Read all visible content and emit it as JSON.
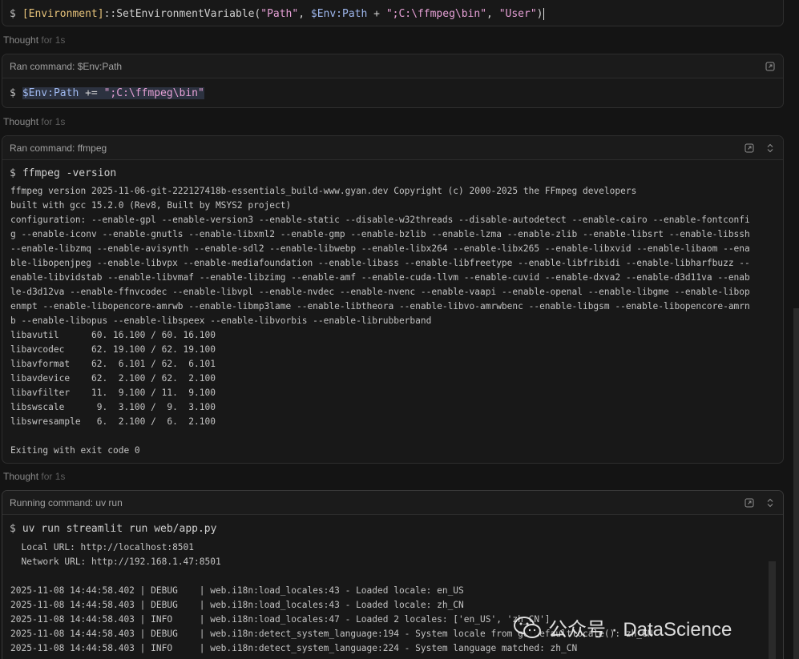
{
  "cards": {
    "card1": {
      "cmd": {
        "prompt": "$",
        "p1": "[Environment]",
        "p2": "::SetEnvironmentVariable(",
        "p3": "\"Path\"",
        "p4": ", ",
        "p5": "$Env:Path",
        "p6": " + ",
        "p7": "\";C:\\ffmpeg\\bin\"",
        "p8": ", ",
        "p9": "\"User\"",
        "p10": ")"
      }
    },
    "card2": {
      "title": "Ran command: $Env:Path",
      "cmd": {
        "prompt": "$",
        "p1": "$Env:Path",
        "p2": " += ",
        "p3": "\";C:\\ffmpeg\\bin\""
      }
    },
    "card3": {
      "title": "Ran command: ffmpeg",
      "cmd": {
        "prompt": "$",
        "text": "ffmpeg -version"
      },
      "output": [
        "ffmpeg version 2025-11-06-git-222127418b-essentials_build-www.gyan.dev Copyright (c) 2000-2025 the FFmpeg developers",
        "built with gcc 15.2.0 (Rev8, Built by MSYS2 project)",
        "configuration: --enable-gpl --enable-version3 --enable-static --disable-w32threads --disable-autodetect --enable-cairo --enable-fontconfi",
        "g --enable-iconv --enable-gnutls --enable-libxml2 --enable-gmp --enable-bzlib --enable-lzma --enable-zlib --enable-libsrt --enable-libssh",
        "--enable-libzmq --enable-avisynth --enable-sdl2 --enable-libwebp --enable-libx264 --enable-libx265 --enable-libxvid --enable-libaom --ena",
        "ble-libopenjpeg --enable-libvpx --enable-mediafoundation --enable-libass --enable-libfreetype --enable-libfribidi --enable-libharfbuzz --",
        "enable-libvidstab --enable-libvmaf --enable-libzimg --enable-amf --enable-cuda-llvm --enable-cuvid --enable-dxva2 --enable-d3d11va --enab",
        "le-d3d12va --enable-ffnvcodec --enable-libvpl --enable-nvdec --enable-nvenc --enable-vaapi --enable-openal --enable-libgme --enable-libop",
        "enmpt --enable-libopencore-amrwb --enable-libmp3lame --enable-libtheora --enable-libvo-amrwbenc --enable-libgsm --enable-libopencore-amrn",
        "b --enable-libopus --enable-libspeex --enable-libvorbis --enable-librubberband",
        "libavutil      60. 16.100 / 60. 16.100",
        "libavcodec     62. 19.100 / 62. 19.100",
        "libavformat    62.  6.101 / 62.  6.101",
        "libavdevice    62.  2.100 / 62.  2.100",
        "libavfilter    11.  9.100 / 11.  9.100",
        "libswscale      9.  3.100 /  9.  3.100",
        "libswresample   6.  2.100 /  6.  2.100",
        "",
        "Exiting with exit code 0"
      ]
    },
    "card4": {
      "title": "Running command: uv run",
      "cmd": {
        "prompt": "$",
        "text": "uv run streamlit run web/app.py"
      },
      "output": [
        "  Local URL: http://localhost:8501",
        "  Network URL: http://192.168.1.47:8501",
        "",
        "2025-11-08 14:44:58.402 | DEBUG    | web.i18n:load_locales:43 - Loaded locale: en_US",
        "2025-11-08 14:44:58.403 | DEBUG    | web.i18n:load_locales:43 - Loaded locale: zh_CN",
        "2025-11-08 14:44:58.403 | INFO     | web.i18n:load_locales:47 - Loaded 2 locales: ['en_US', 'zh_CN']",
        "2025-11-08 14:44:58.403 | DEBUG    | web.i18n:detect_system_language:194 - System locale from getdefaultlocale(): zh_CN",
        "2025-11-08 14:44:58.403 | INFO     | web.i18n:detect_system_language:224 - System language matched: zh_CN"
      ]
    }
  },
  "thoughts": {
    "t1": {
      "label": "Thought",
      "duration": "for 1s"
    },
    "t2": {
      "label": "Thought",
      "duration": "for 1s"
    },
    "t3": {
      "label": "Thought",
      "duration": "for 1s"
    }
  },
  "watermark": {
    "text": "公众号 · DataScience"
  },
  "icons": {
    "open": "open-external-icon",
    "collapse": "chevron-up-down-icon"
  }
}
